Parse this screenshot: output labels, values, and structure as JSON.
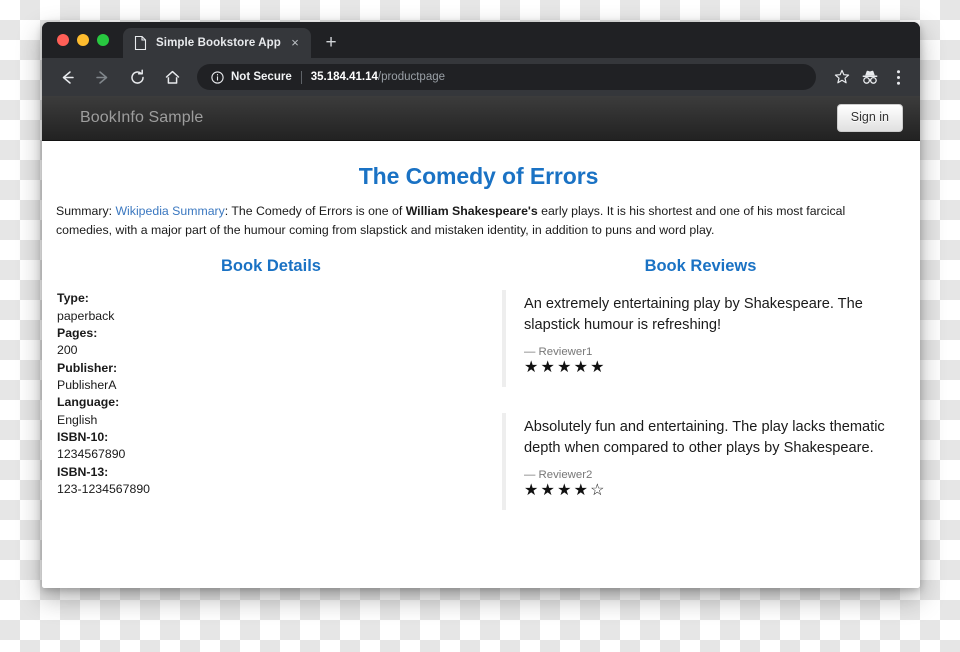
{
  "browser": {
    "traffic_lights": [
      "close",
      "minimize",
      "maximize"
    ],
    "tab": {
      "title": "Simple Bookstore App",
      "favicon": "page-icon",
      "close": "×"
    },
    "new_tab_label": "+",
    "nav": {
      "back": "←",
      "forward": "→",
      "reload": "⟳",
      "home": "⌂"
    },
    "omnibox": {
      "security_icon": "info-circle-icon",
      "security_label": "Not Secure",
      "url_host": "35.184.41.14",
      "url_path": "/productpage"
    },
    "toolbar_icons": [
      "bookmark-star-icon",
      "incognito-icon",
      "overflow-menu-icon"
    ]
  },
  "site": {
    "brand": "BookInfo Sample",
    "signin_label": "Sign in"
  },
  "page": {
    "title": "The Comedy of Errors",
    "summary": {
      "prefix": "Summary: ",
      "link_text": "Wikipedia Summary",
      "after_link": ": The Comedy of Errors is one of ",
      "bold_text": "William Shakespeare's",
      "rest": " early plays. It is his shortest and one of his most farcical comedies, with a major part of the humour coming from slapstick and mistaken identity, in addition to puns and word play."
    },
    "details": {
      "heading": "Book Details",
      "items": [
        {
          "key": "Type:",
          "value": "paperback"
        },
        {
          "key": "Pages:",
          "value": "200"
        },
        {
          "key": "Publisher:",
          "value": "PublisherA"
        },
        {
          "key": "Language:",
          "value": "English"
        },
        {
          "key": "ISBN-10:",
          "value": "1234567890"
        },
        {
          "key": "ISBN-13:",
          "value": "123-1234567890"
        }
      ]
    },
    "reviews": {
      "heading": "Book Reviews",
      "items": [
        {
          "text": "An extremely entertaining play by Shakespeare. The slapstick humour is refreshing!",
          "author": "— Reviewer1",
          "stars": "★★★★★",
          "rating": 5
        },
        {
          "text": "Absolutely fun and entertaining. The play lacks thematic depth when compared to other plays by Shakespeare.",
          "author": "— Reviewer2",
          "stars": "★★★★☆",
          "rating": 4
        }
      ]
    }
  },
  "colors": {
    "accent_blue": "#1a72c4",
    "link_blue": "#3b78c0",
    "navbar_dark": "#222222",
    "chrome_dark": "#35373b",
    "tabstrip_dark": "#202124"
  }
}
